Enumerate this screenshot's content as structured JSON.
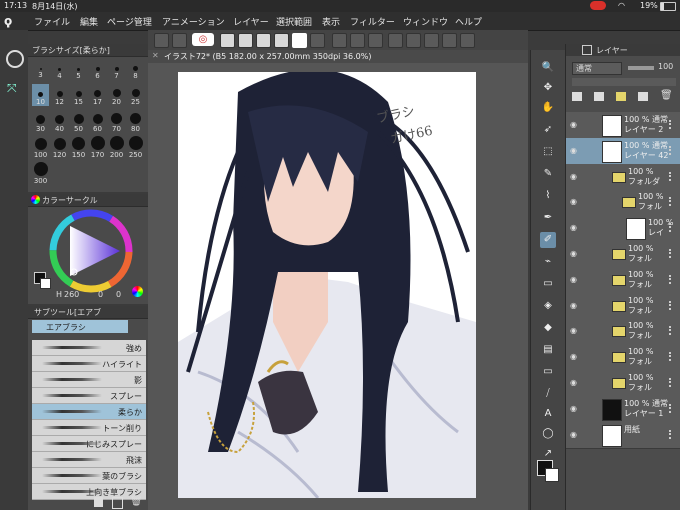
{
  "status": {
    "time": "17:13",
    "date": "8月14日(水)",
    "battery": "19%"
  },
  "menu": [
    "ファイル",
    "編集",
    "ページ管理",
    "アニメーション",
    "レイヤー",
    "選択範囲",
    "表示",
    "フィルター",
    "ウィンドウ",
    "ヘルプ"
  ],
  "brush_size": {
    "title": "ブラシサイズ[柔らか]",
    "sizes": [
      "3",
      "4",
      "5",
      "6",
      "7",
      "8",
      "10",
      "12",
      "15",
      "17",
      "20",
      "25",
      "30",
      "40",
      "50",
      "60",
      "70",
      "80",
      "100",
      "120",
      "150",
      "170",
      "200",
      "250",
      "300"
    ],
    "selected": "10"
  },
  "color_circle": {
    "title": "カラーサークル",
    "h_label": "H",
    "h": "260",
    "s": "0",
    "v": "0"
  },
  "sub_tool": {
    "title": "サブツール[エアブ",
    "group": "エアブラシ",
    "items": [
      "強め",
      "ハイライト",
      "影",
      "スプレー",
      "柔らか",
      "トーン削り",
      "にじみスプレー",
      "飛沫",
      "葉のブラシ",
      "上向き草ブラシ"
    ],
    "selected": "柔らか"
  },
  "canvas": {
    "tab": "イラスト72* (B5 182.00 x 257.00mm 350dpi 36.0%)",
    "handwriting_line1": "ブラシ",
    "handwriting_line2": "ガけ66"
  },
  "layers_panel": {
    "title": "レイヤー",
    "blend": "通常",
    "opacity": "100",
    "rows": [
      {
        "pct": "100 % 通常",
        "name": "レイヤー 2"
      },
      {
        "pct": "100 % 通常",
        "name": "レイヤー 42"
      },
      {
        "pct": "100 %",
        "name": "フォルダ"
      },
      {
        "pct": "100 %",
        "name": "フォル"
      },
      {
        "pct": "100 %",
        "name": "レイ"
      },
      {
        "pct": "100 %",
        "name": "フォル"
      },
      {
        "pct": "100 %",
        "name": "フォル"
      },
      {
        "pct": "100 %",
        "name": "フォル"
      },
      {
        "pct": "100 %",
        "name": "フォル"
      },
      {
        "pct": "100 %",
        "name": "フォル"
      },
      {
        "pct": "100 %",
        "name": "フォル"
      },
      {
        "pct": "100 % 通常",
        "name": "レイヤー 1"
      },
      {
        "pct": "",
        "name": "用紙"
      }
    ]
  },
  "accent": "#6b8ea8"
}
